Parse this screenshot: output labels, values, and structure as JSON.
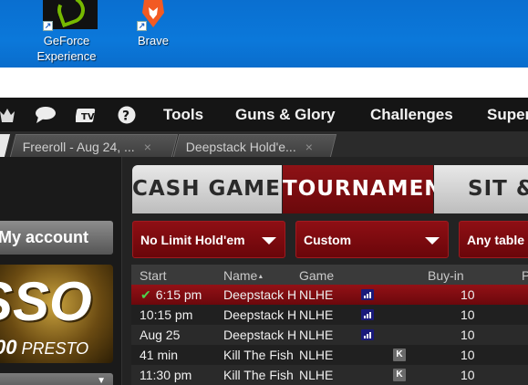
{
  "desktop": {
    "icons": [
      {
        "name": "geforce",
        "label_line1": "GeForce",
        "label_line2": "Experience"
      },
      {
        "name": "brave",
        "label_line1": "Brave"
      }
    ]
  },
  "menubar": {
    "items": [
      "Tools",
      "Guns & Glory",
      "Challenges",
      "Super"
    ]
  },
  "tabs": [
    {
      "title": "Freeroll - Aug 24, ...",
      "close": "×"
    },
    {
      "title": "Deepstack Hold'e...",
      "close": "×"
    }
  ],
  "sidebar": {
    "account_label": "My account",
    "promo_big": "SSO",
    "promo_small_num": "00",
    "promo_small_text": "PRESTO"
  },
  "lobby": {
    "categories": [
      "CASH GAMES",
      "TOURNAMENTS",
      "SIT & G"
    ],
    "active_category": "TOURNAMENTS",
    "filters": [
      "No Limit Hold'em",
      "Custom",
      "Any table"
    ],
    "columns": [
      "Start",
      "Name",
      "Game",
      "Buy-in",
      "P"
    ],
    "sort_indicator": "▲",
    "rows": [
      {
        "start": "6:15 pm",
        "name": "Deepstack H",
        "game": "NLHE",
        "badge": "bars",
        "buyin": "10",
        "selected": true,
        "checked": true
      },
      {
        "start": "10:15 pm",
        "name": "Deepstack H",
        "game": "NLHE",
        "badge": "bars",
        "buyin": "10"
      },
      {
        "start": "Aug 25",
        "name": "Deepstack H",
        "game": "NLHE",
        "badge": "bars",
        "buyin": "10"
      },
      {
        "start": "41 min",
        "name": "Kill The Fish",
        "game": "NLHE",
        "badge": "K",
        "buyin": "10"
      },
      {
        "start": "11:30 pm",
        "name": "Kill The Fish",
        "game": "NLHE",
        "badge": "K",
        "buyin": "10"
      }
    ]
  },
  "colors": {
    "desktop_blue": "#0b78da",
    "accent_red": "#8e1216",
    "check_green": "#4cd34c"
  }
}
